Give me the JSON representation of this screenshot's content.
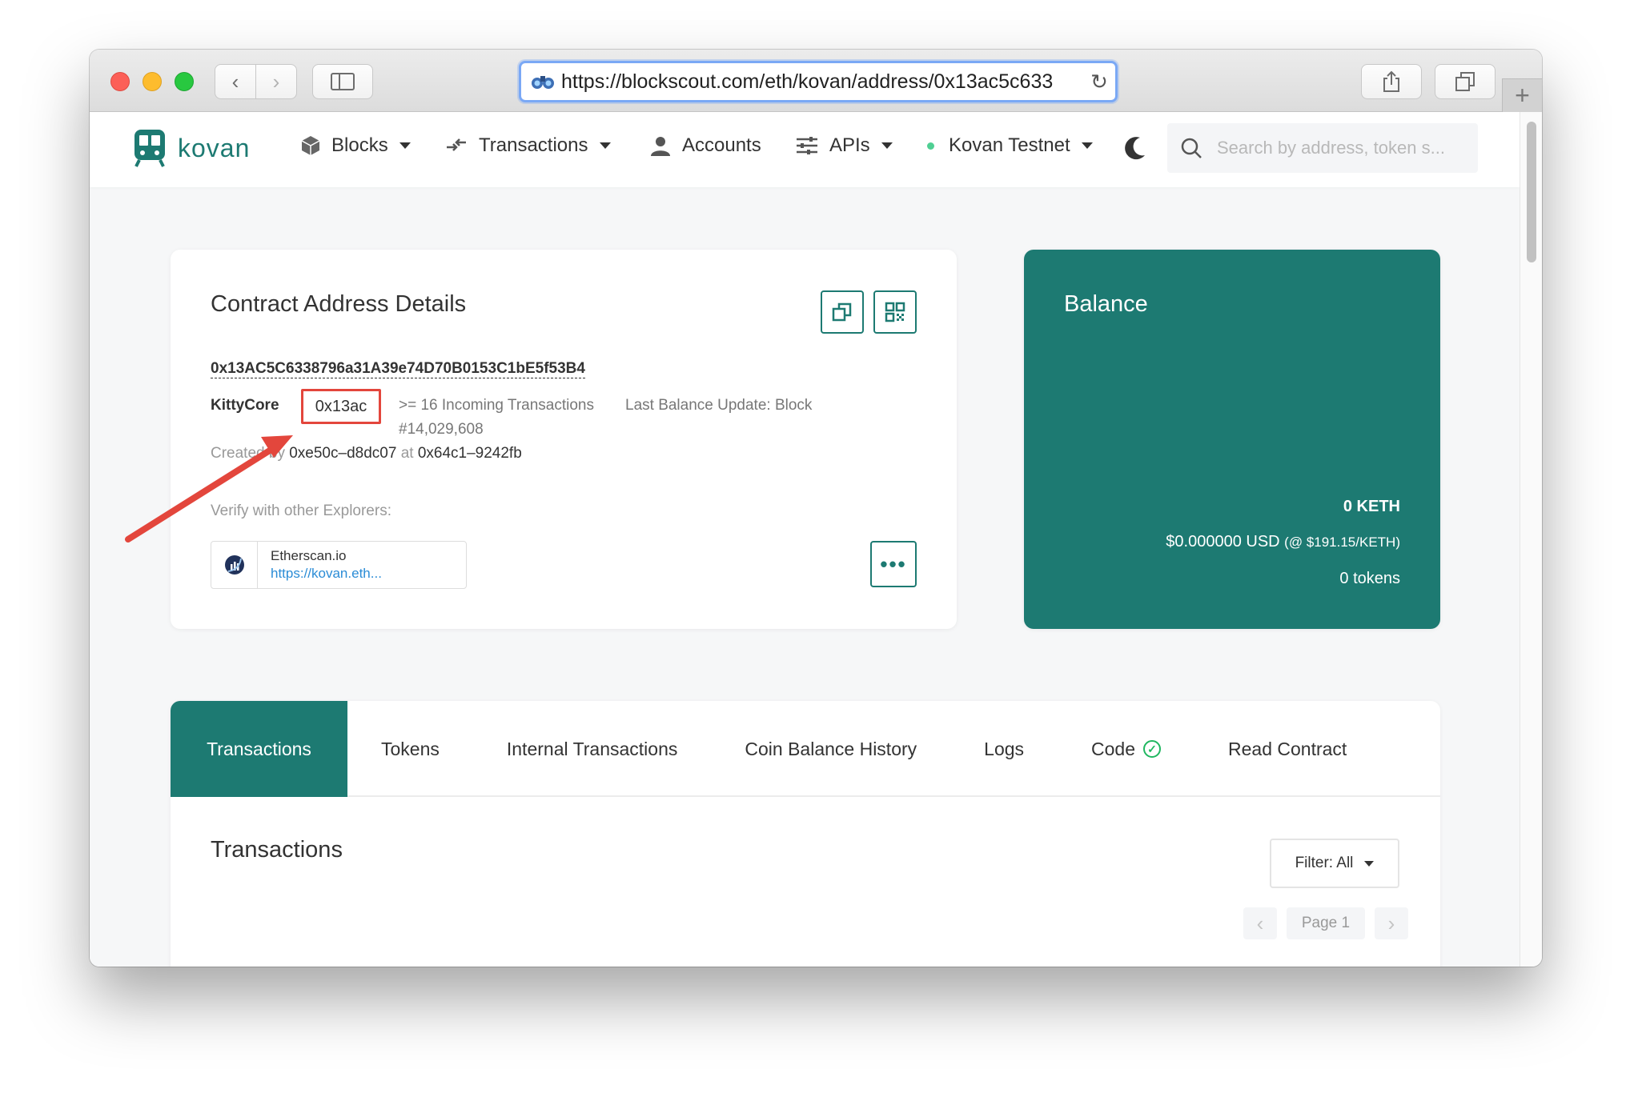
{
  "browser": {
    "url": "https://blockscout.com/eth/kovan/address/0x13ac5c633"
  },
  "navbar": {
    "brand": "kovan",
    "items": [
      {
        "label": "Blocks"
      },
      {
        "label": "Transactions"
      },
      {
        "label": "Accounts"
      },
      {
        "label": "APIs"
      },
      {
        "label": "Kovan Testnet"
      }
    ],
    "search_placeholder": "Search by address, token s..."
  },
  "details": {
    "title": "Contract Address Details",
    "address": "0x13AC5C6338796a31A39e74D70B0153C1bE5f53B4",
    "name": "KittyCore",
    "short_hash": "0x13ac",
    "incoming": ">= 16 Incoming Transactions",
    "last_update": "Last Balance Update: Block",
    "block_number": "#14,029,608",
    "created_prefix": "Created by",
    "creator": "0xe50c–d8dc07",
    "at_word": "at",
    "creation_tx": "0x64c1–9242fb",
    "verify_label": "Verify with other Explorers:",
    "explorer_name": "Etherscan.io",
    "explorer_link": "https://kovan.eth..."
  },
  "balance": {
    "title": "Balance",
    "keth": "0 KETH",
    "usd": "$0.000000 USD",
    "rate": "(@ $191.15/KETH)",
    "tokens": "0 tokens"
  },
  "tabs": [
    {
      "label": "Transactions"
    },
    {
      "label": "Tokens"
    },
    {
      "label": "Internal Transactions"
    },
    {
      "label": "Coin Balance History"
    },
    {
      "label": "Logs"
    },
    {
      "label": "Code"
    },
    {
      "label": "Read Contract"
    }
  ],
  "transactions": {
    "title": "Transactions",
    "filter": "Filter: All",
    "page": "Page 1"
  },
  "colors": {
    "brand": "#1d7a72",
    "annotation": "#e3463c"
  }
}
